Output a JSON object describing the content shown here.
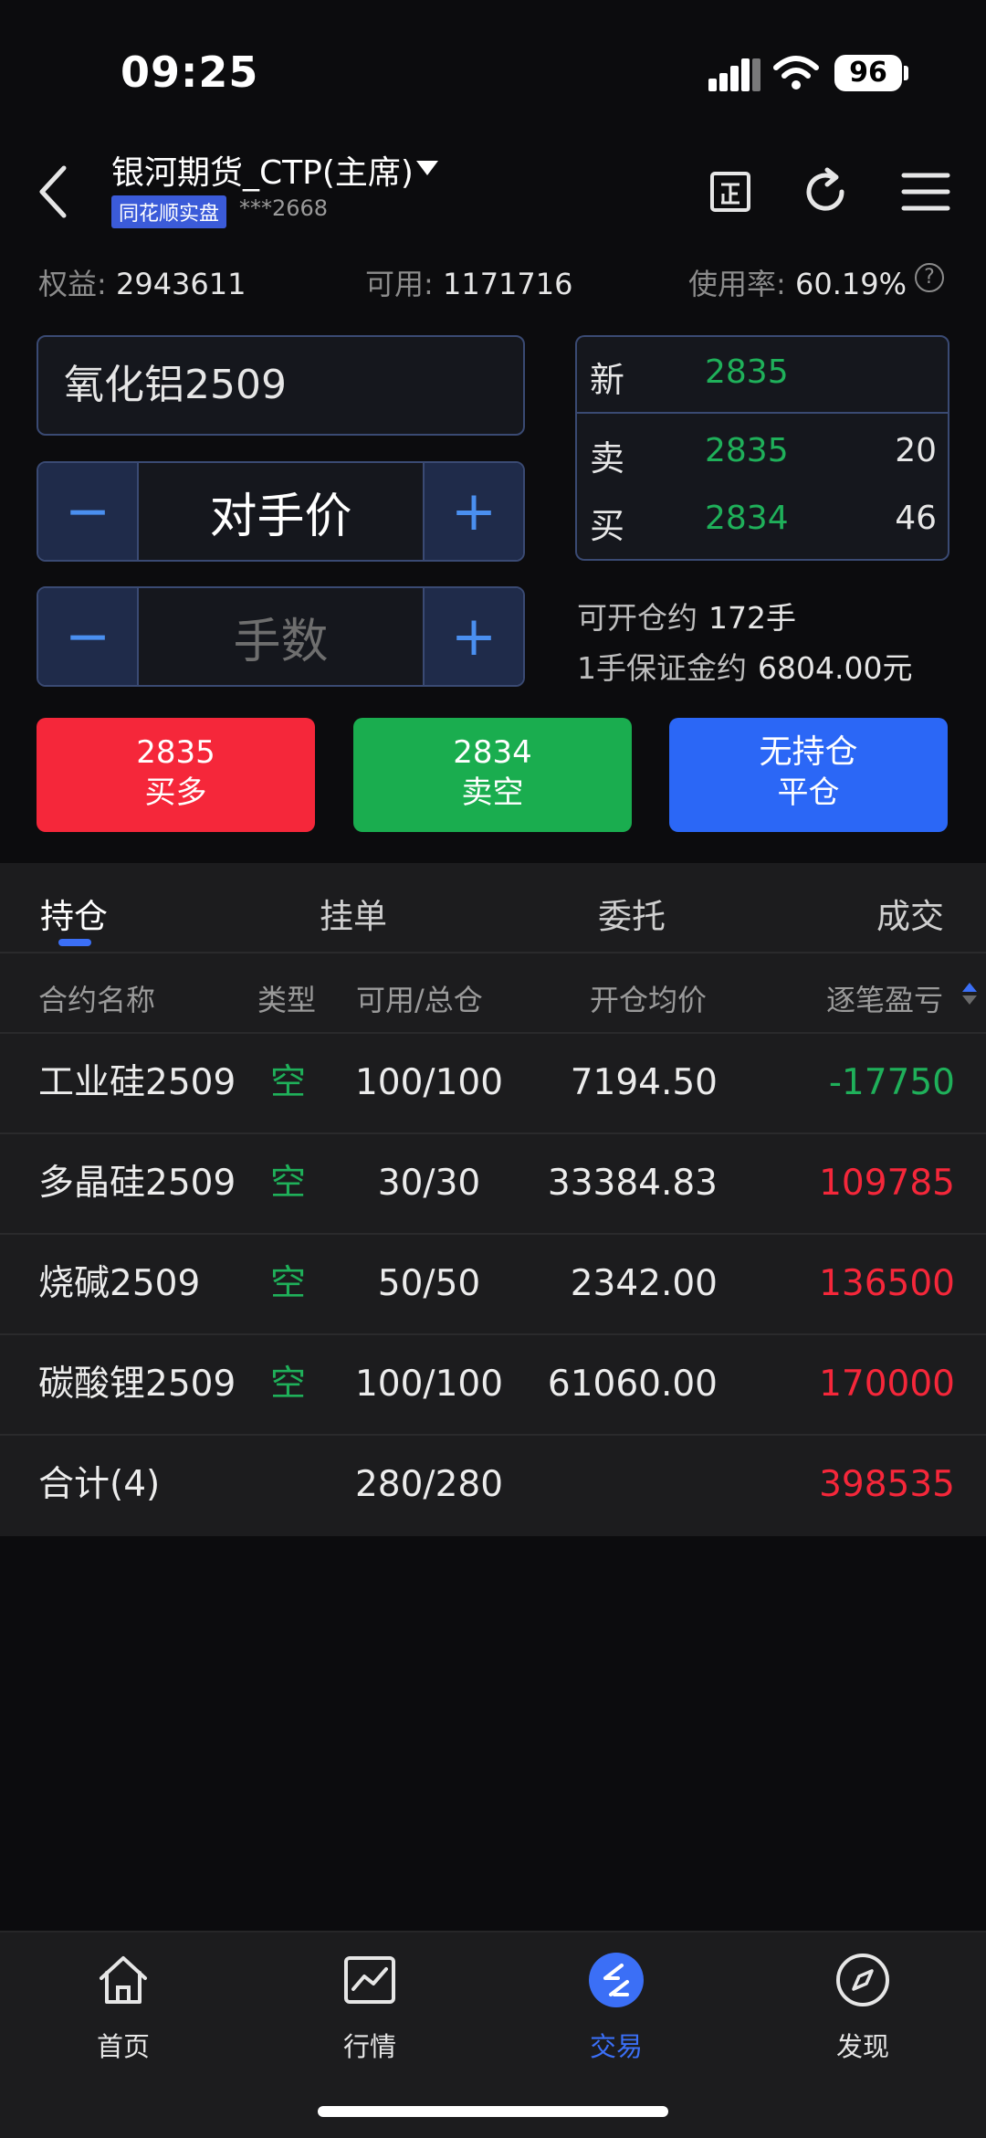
{
  "status_bar": {
    "time": "09:25",
    "battery": "96"
  },
  "header": {
    "account_name": "银河期货_CTP(主席)",
    "badge": "同花顺实盘",
    "account_number": "***2668"
  },
  "stats": {
    "equity_label": "权益:",
    "equity_value": "2943611",
    "available_label": "可用:",
    "available_value": "1171716",
    "usage_label": "使用率:",
    "usage_value": "60.19%"
  },
  "order": {
    "contract": "氧化铝2509",
    "price_mode": "对手价",
    "quantity_placeholder": "手数",
    "minus": "−",
    "plus": "+"
  },
  "quote": {
    "last_label": "新",
    "last_price": "2835",
    "ask_label": "卖",
    "ask_price": "2835",
    "ask_volume": "20",
    "bid_label": "买",
    "bid_price": "2834",
    "bid_volume": "46"
  },
  "info": {
    "openable_label": "可开仓约",
    "openable_value": "172手",
    "margin_label": "1手保证金约",
    "margin_value": "6804.00元"
  },
  "actions": {
    "buy_price": "2835",
    "buy_label": "买多",
    "sell_price": "2834",
    "sell_label": "卖空",
    "close_status": "无持仓",
    "close_label": "平仓"
  },
  "tabs": [
    "持仓",
    "挂单",
    "委托",
    "成交"
  ],
  "table": {
    "headers": [
      "合约名称",
      "类型",
      "可用/总仓",
      "开仓均价",
      "逐笔盈亏"
    ],
    "rows": [
      {
        "name": "工业硅2509",
        "type": "空",
        "qty": "100/100",
        "avg": "7194.50",
        "pnl": "-17750"
      },
      {
        "name": "多晶硅2509",
        "type": "空",
        "qty": "30/30",
        "avg": "33384.83",
        "pnl": "109785"
      },
      {
        "name": "烧碱2509",
        "type": "空",
        "qty": "50/50",
        "avg": "2342.00",
        "pnl": "136500"
      },
      {
        "name": "碳酸锂2509",
        "type": "空",
        "qty": "100/100",
        "avg": "61060.00",
        "pnl": "170000"
      }
    ],
    "total": {
      "name": "合计(4)",
      "qty": "280/280",
      "pnl": "398535"
    }
  },
  "nav": [
    {
      "label": "首页",
      "icon": "home-icon"
    },
    {
      "label": "行情",
      "icon": "chart-icon"
    },
    {
      "label": "交易",
      "icon": "trade-icon"
    },
    {
      "label": "发现",
      "icon": "compass-icon"
    }
  ],
  "colors": {
    "up": "#f5273a",
    "down": "#1fb05a",
    "accent": "#2b67f6"
  }
}
